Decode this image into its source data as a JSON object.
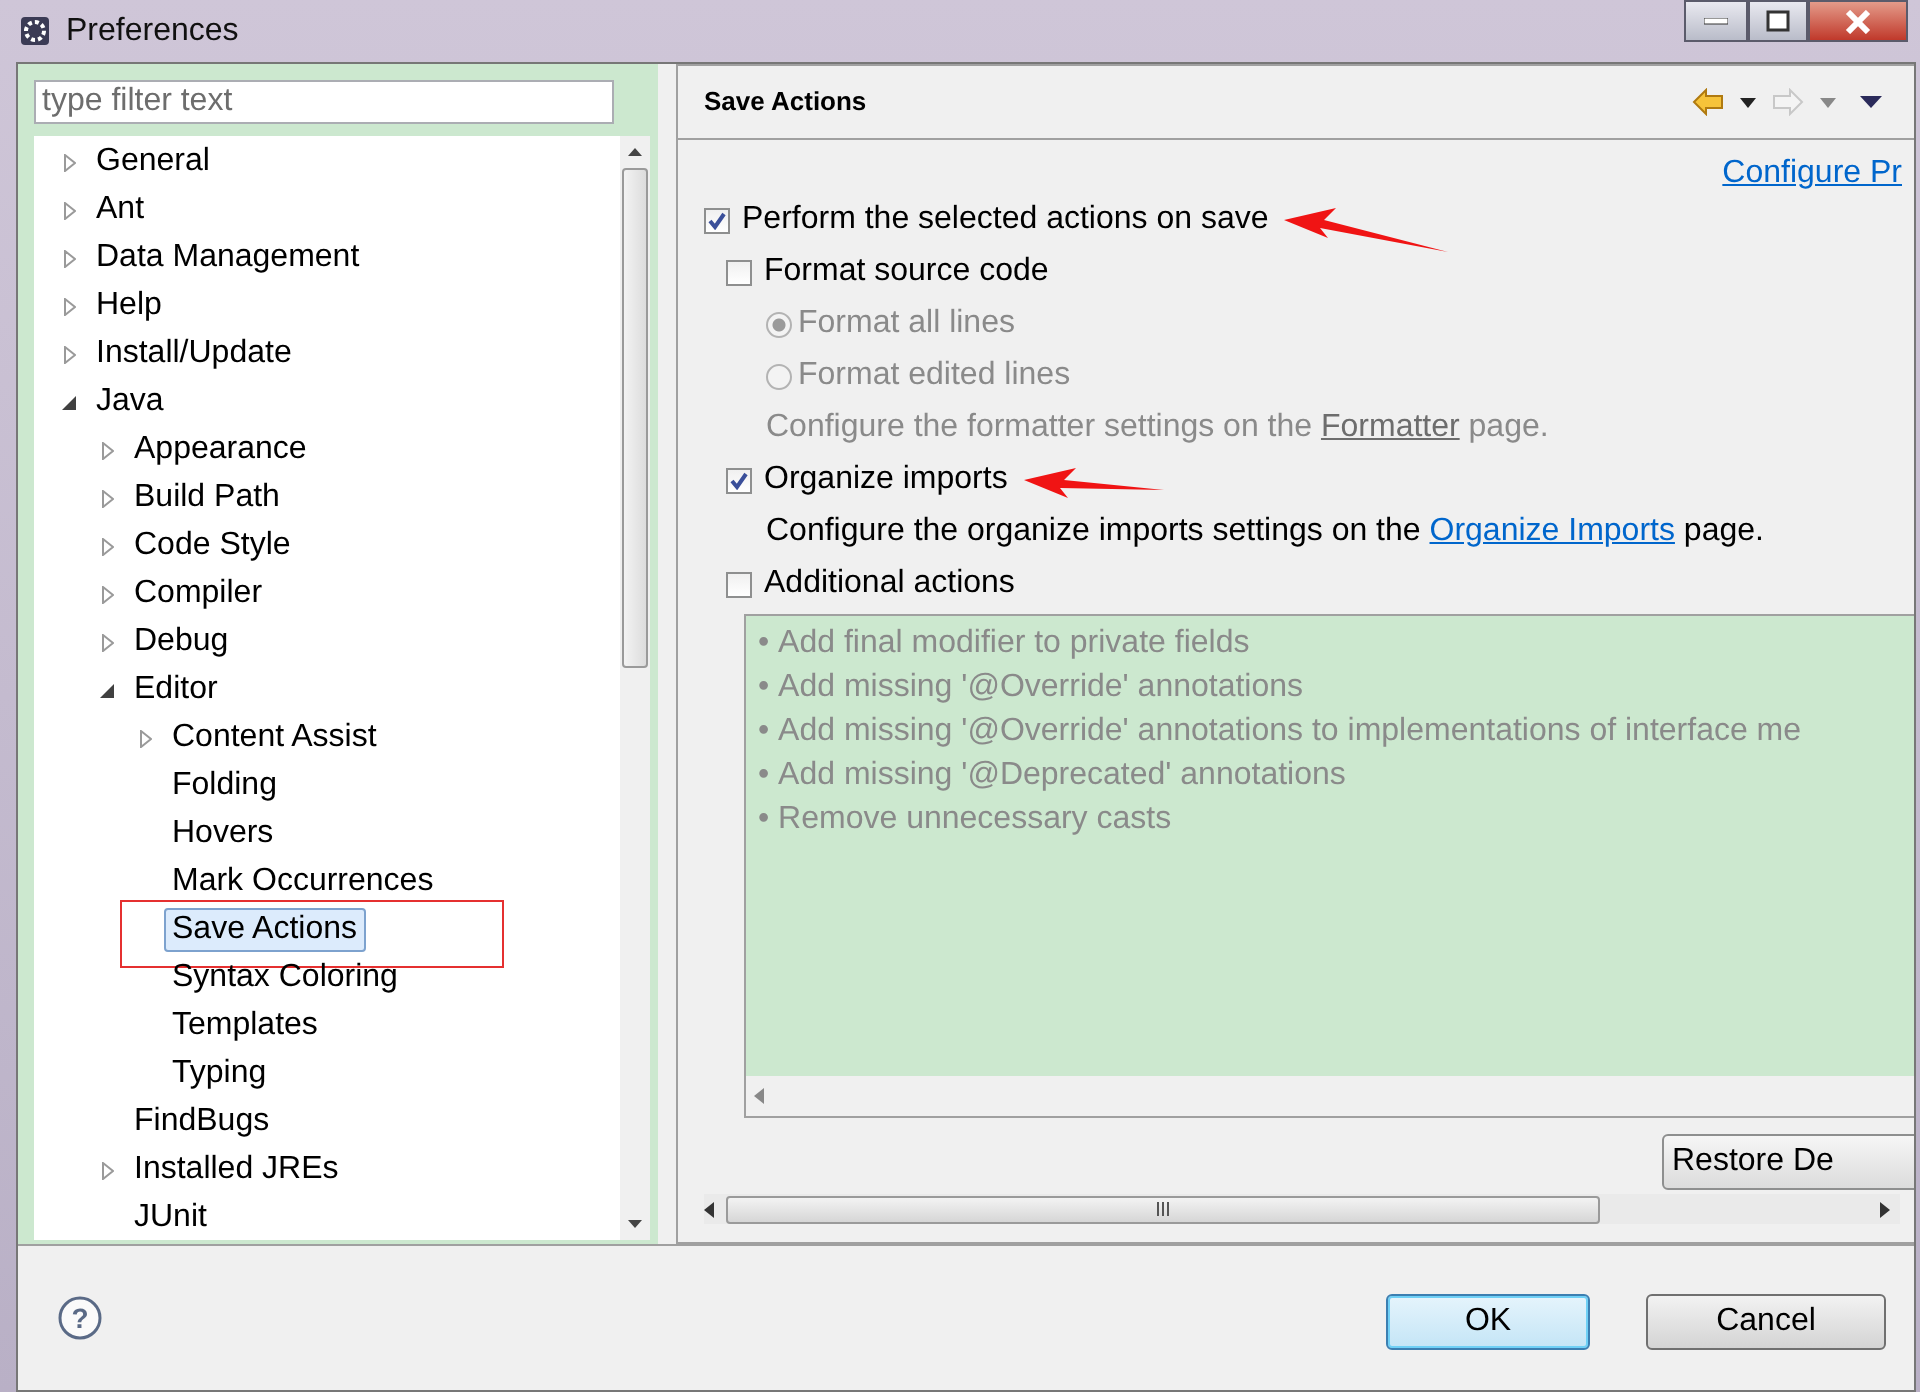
{
  "window": {
    "title": "Preferences"
  },
  "filter": {
    "placeholder": "type filter text"
  },
  "tree": [
    {
      "label": "General",
      "expanded": false,
      "selected": false,
      "annotated": false
    },
    {
      "label": "Ant",
      "expanded": false,
      "selected": false,
      "annotated": false
    },
    {
      "label": "Data Management",
      "expanded": false,
      "selected": false,
      "annotated": false
    },
    {
      "label": "Help",
      "expanded": false,
      "selected": false,
      "annotated": false
    },
    {
      "label": "Install/Update",
      "expanded": false,
      "selected": false,
      "annotated": false
    },
    {
      "label": "Java",
      "expanded": true,
      "selected": false,
      "annotated": false,
      "children": [
        {
          "label": "Appearance",
          "expanded": false,
          "selected": false,
          "annotated": false
        },
        {
          "label": "Build Path",
          "expanded": false,
          "selected": false,
          "annotated": false
        },
        {
          "label": "Code Style",
          "expanded": false,
          "selected": false,
          "annotated": false
        },
        {
          "label": "Compiler",
          "expanded": false,
          "selected": false,
          "annotated": false
        },
        {
          "label": "Debug",
          "expanded": false,
          "selected": false,
          "annotated": false
        },
        {
          "label": "Editor",
          "expanded": true,
          "selected": false,
          "annotated": false,
          "children": [
            {
              "label": "Content Assist",
              "expanded": false,
              "selected": false,
              "annotated": false
            },
            {
              "label": "Folding",
              "selected": false,
              "annotated": false
            },
            {
              "label": "Hovers",
              "selected": false,
              "annotated": false
            },
            {
              "label": "Mark Occurrences",
              "selected": false,
              "annotated": false
            },
            {
              "label": "Save Actions",
              "selected": true,
              "annotated": true
            },
            {
              "label": "Syntax Coloring",
              "selected": false,
              "annotated": false
            },
            {
              "label": "Templates",
              "selected": false,
              "annotated": false
            },
            {
              "label": "Typing",
              "selected": false,
              "annotated": false
            }
          ]
        },
        {
          "label": "FindBugs",
          "selected": false,
          "annotated": false
        },
        {
          "label": "Installed JREs",
          "expanded": false,
          "selected": false,
          "annotated": false
        },
        {
          "label": "JUnit",
          "selected": false,
          "annotated": false
        }
      ]
    }
  ],
  "page": {
    "title": "Save Actions",
    "history": {
      "back_enabled": true,
      "forward_enabled": false
    },
    "link": "Configure Pr",
    "settings": [
      {
        "kind": "checkbox",
        "label": "Perform the selected actions on save",
        "checked": true,
        "disabled": false,
        "annotated": true,
        "children": [
          {
            "kind": "checkbox",
            "label": "Format source code",
            "checked": false,
            "disabled": false,
            "annotated": false,
            "children": [
              {
                "kind": "radio",
                "label": "Format all lines",
                "selected": true,
                "disabled": true
              },
              {
                "kind": "radio",
                "label": "Format edited lines",
                "selected": false,
                "disabled": true
              },
              {
                "kind": "note",
                "before": "Configure the formatter settings on the ",
                "link": "Formatter",
                "after": " page.",
                "disabled": true
              }
            ]
          },
          {
            "kind": "checkbox",
            "label": "Organize imports",
            "checked": true,
            "disabled": false,
            "annotated": true,
            "children": [
              {
                "kind": "note",
                "before": "Configure the organize imports settings on the ",
                "link": "Organize Imports",
                "after": " page.",
                "disabled": false
              }
            ]
          },
          {
            "kind": "checkbox",
            "label": "Additional actions",
            "checked": false,
            "disabled": false,
            "annotated": false,
            "children": [
              {
                "kind": "listbox",
                "disabled": true,
                "items": [
                  {
                    "bullet": "•",
                    "text": "Add final modifier to private fields"
                  },
                  {
                    "bullet": "•",
                    "text": "Add missing '@Override' annotations"
                  },
                  {
                    "bullet": "•",
                    "text": "Add missing '@Override' annotations to implementations of interface me"
                  },
                  {
                    "bullet": "•",
                    "text": "Add missing '@Deprecated' annotations"
                  },
                  {
                    "bullet": "•",
                    "text": "Remove unnecessary casts"
                  }
                ]
              }
            ]
          }
        ]
      }
    ],
    "restore_button": "Restore De"
  },
  "help": "?",
  "buttons": [
    {
      "label": "OK",
      "default": true
    },
    {
      "label": "Cancel",
      "default": false
    }
  ]
}
